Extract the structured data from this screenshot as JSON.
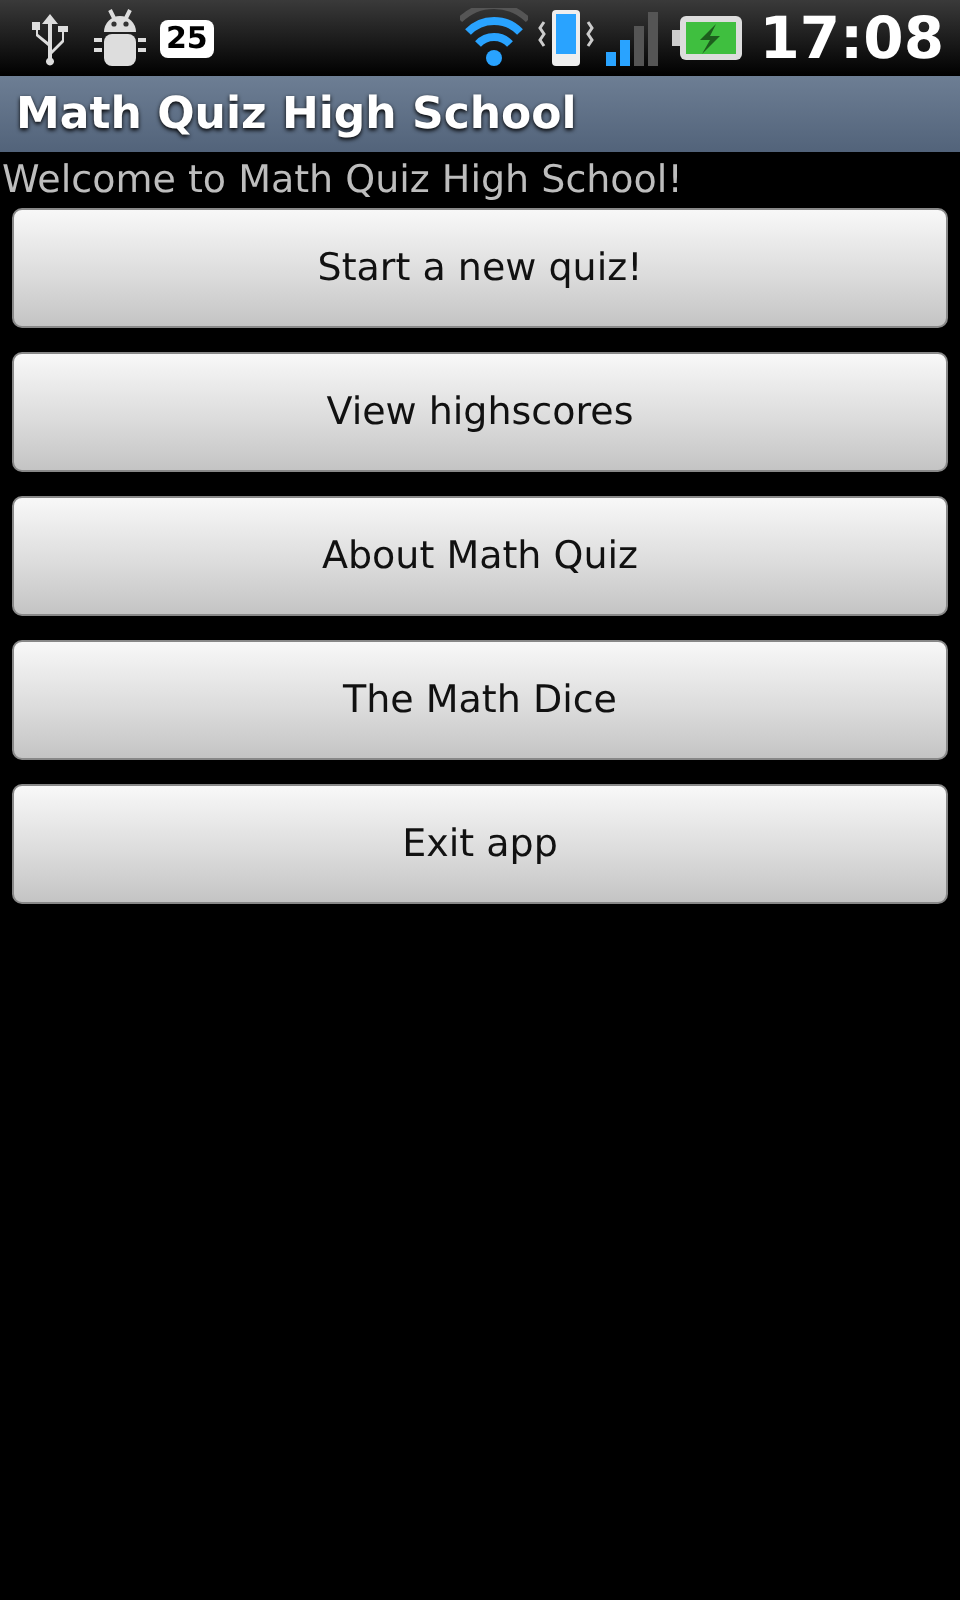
{
  "status_bar": {
    "notification_count": "25",
    "time": "17:08"
  },
  "title_bar": {
    "title": "Math Quiz High School"
  },
  "welcome": "Welcome to Math Quiz High School!",
  "buttons": [
    "Start a new quiz!",
    "View highscores",
    "About Math Quiz",
    "The Math Dice",
    "Exit app"
  ]
}
